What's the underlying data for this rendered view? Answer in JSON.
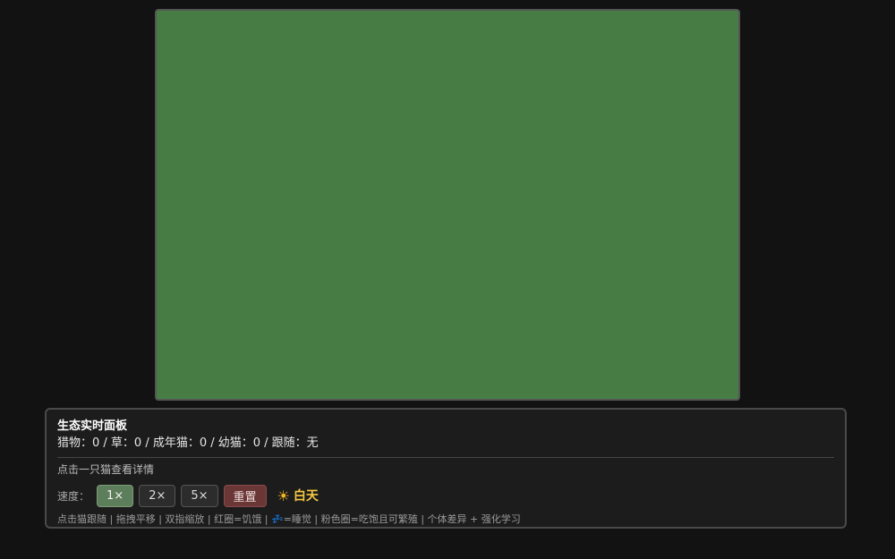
{
  "panel": {
    "title": "生态实时面板",
    "stats": "猎物：0 / 草：0 / 成年猫：0 / 幼猫：0 / 跟随：无",
    "hint": "点击一只猫查看详情"
  },
  "controls": {
    "speed_label": "速度：",
    "speeds": [
      "1×",
      "2×",
      "5×"
    ],
    "active_speed": "1×",
    "reset_label": "重置",
    "daytime_label": "白天",
    "daytime_icon": "sun-icon"
  },
  "footer": {
    "part1": "点击猫跟随 | 拖拽平移 | 双指缩放 | 红圈=饥饿 | ",
    "sleep_icon": "💤",
    "part2": "=睡觉 | 粉色圈=吃饱且可繁殖 | 个体差异 + 强化学习"
  },
  "colors": {
    "field": "#477d45",
    "background": "#121212",
    "active_button": "#5d7e5a",
    "reset_button": "#6a3636",
    "daytime": "#f5c842"
  }
}
